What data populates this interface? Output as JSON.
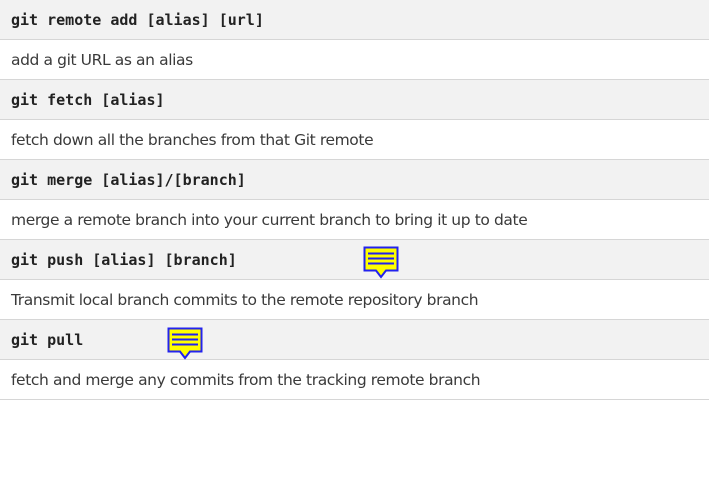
{
  "commands": [
    {
      "cmd": "git remote add [alias] [url]",
      "desc": "add a git URL as an alias"
    },
    {
      "cmd": "git fetch [alias]",
      "desc": "fetch down all the branches from that Git remote"
    },
    {
      "cmd": "git merge [alias]/[branch]",
      "desc": "merge a remote branch into your current branch to bring it up to date"
    },
    {
      "cmd": "git push [alias] [branch]",
      "desc": "Transmit local branch commits to the remote repository branch"
    },
    {
      "cmd": "git pull",
      "desc": "fetch and merge any commits from the tracking remote branch"
    }
  ],
  "annotations": [
    {
      "icon": "sticky-note-icon",
      "color": "#ffff00",
      "outline": "#2222ee"
    },
    {
      "icon": "sticky-note-icon",
      "color": "#ffff00",
      "outline": "#2222ee"
    }
  ]
}
